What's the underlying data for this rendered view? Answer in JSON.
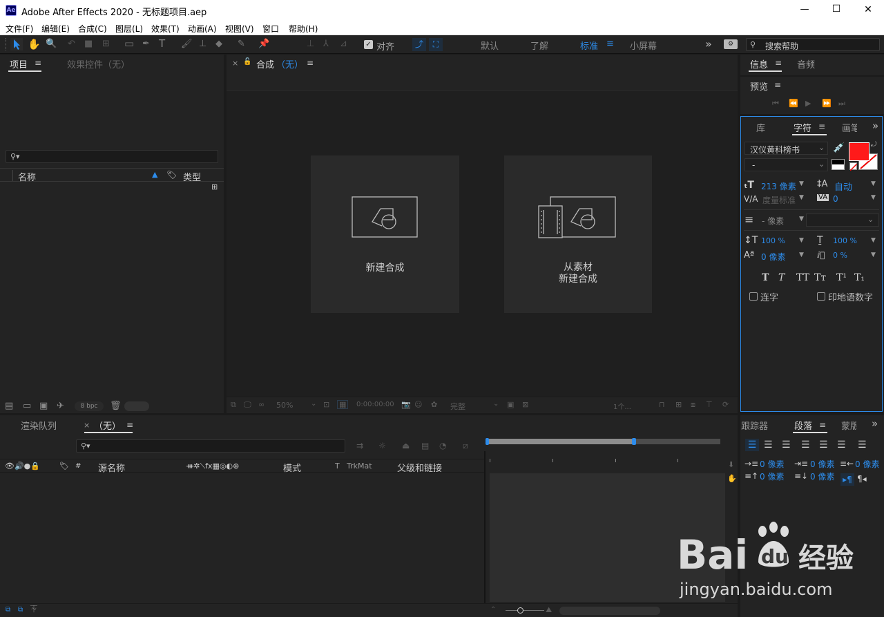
{
  "window": {
    "title": "Adobe After Effects 2020 - 无标题项目.aep",
    "logo": "Ae",
    "min_label": "—",
    "max_label": "☐",
    "close_label": "✕"
  },
  "menu": [
    "文件(F)",
    "编辑(E)",
    "合成(C)",
    "图层(L)",
    "效果(T)",
    "动画(A)",
    "视图(V)",
    "窗口",
    "帮助(H)"
  ],
  "toolbar": {
    "snap_label": "对齐",
    "workspaces": [
      "默认",
      "了解",
      "标准",
      "小屏幕"
    ],
    "active_workspace": "标准",
    "overflow": "»",
    "search_placeholder": "搜索帮助"
  },
  "project_panel": {
    "tab_project": "项目",
    "tab_effects": "效果控件（无）",
    "col_name": "名称",
    "col_type": "类型",
    "bpc": "8 bpc"
  },
  "comp_panel": {
    "close": "×",
    "tab_label": "合成",
    "tab_value": "（无）",
    "card_new_comp": "新建合成",
    "card_from_footage_1": "从素材",
    "card_from_footage_2": "新建合成",
    "zoom": "50%",
    "timecode": "0:00:00:00",
    "quality": "完整",
    "view_count": "1个..."
  },
  "info_panel": {
    "tab_info": "信息",
    "tab_audio": "音频",
    "tab_preview": "预览"
  },
  "character_panel": {
    "tab_library": "库",
    "tab_character": "字符",
    "tab_paint": "画笔",
    "font_family": "汉仪黄科榜书",
    "font_style": "-",
    "fill_color": "#ff1a1a",
    "font_size": "213 像素",
    "leading": "自动",
    "kerning": "度量标准",
    "tracking": "0",
    "stroke_width": "- 像素",
    "vscale": "100 %",
    "hscale": "100 %",
    "baseline": "0 像素",
    "tsume": "0 %",
    "ligatures": "连字",
    "hindi_digits": "印地语数字",
    "style_buttons": [
      "T",
      "T",
      "TT",
      "Tт",
      "T¹",
      "T₁"
    ]
  },
  "render_queue": {
    "tab_label": "渲染队列"
  },
  "timeline": {
    "close": "×",
    "tab_label": "（无）",
    "col_hash": "#",
    "col_source": "源名称",
    "col_mode": "模式",
    "col_t": "T",
    "col_trkmat": "TrkMat",
    "col_parent": "父级和链接"
  },
  "paragraph_panel": {
    "tab_tracker": "跟踪器",
    "tab_paragraph": "段落",
    "tab_mask": "蒙版",
    "indent_left": "0 像素",
    "indent_first": "0 像素",
    "indent_right": "0 像素",
    "space_before": "0 像素",
    "space_after": "0 像素"
  },
  "watermark": {
    "text_bai": "Bai",
    "text_du": "du",
    "text_cn": "经验",
    "url": "jingyan.baidu.com"
  }
}
